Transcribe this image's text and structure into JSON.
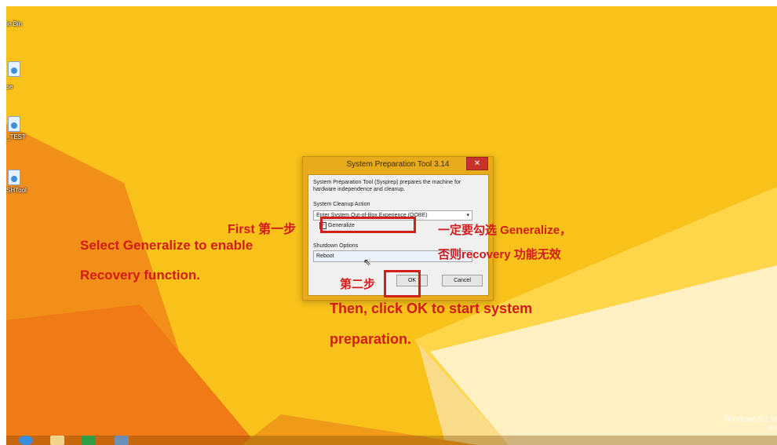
{
  "desktop": {
    "icons": [
      {
        "label": "le Bin",
        "icon": "recycle-bin-icon"
      },
      {
        "label": "",
        "icon": "program-icon"
      },
      {
        "label": "se",
        "icon": "program-icon"
      },
      {
        "label": "_TEST",
        "icon": "program-icon"
      },
      {
        "label": "SHTool",
        "icon": "program-icon"
      }
    ],
    "watermark_line1": "Windows 8.1 w",
    "watermark_line2": "Bu"
  },
  "dialog": {
    "title": "System Preparation Tool 3.14",
    "close_label": "✕",
    "description": "System Preparation Tool (Sysprep) prepares the machine for hardware independence and cleanup.",
    "cleanup_label": "System Cleanup Action",
    "cleanup_value": "Enter System Out-of-Box Experience (OOBE)",
    "generalize_label": "Generalize",
    "generalize_checked": true,
    "shutdown_label": "Shutdown Options",
    "shutdown_value": "Reboot",
    "ok_label": "OK",
    "cancel_label": "Cancel"
  },
  "annotations": {
    "first": "First 第一步",
    "left_line1": "Select Generalize to enable",
    "left_line2": "Recovery function.",
    "right_line1": "一定要勾选 Generalize，",
    "right_line2": "否则recovery 功能无效",
    "step2": "第二步",
    "bottom_line1": "Then, click OK to start system",
    "bottom_line2": "preparation."
  },
  "colors": {
    "wallpaper": "#f8c21a",
    "annotation": "#d21b1b",
    "dialog_frame": "#e8ab1c"
  }
}
